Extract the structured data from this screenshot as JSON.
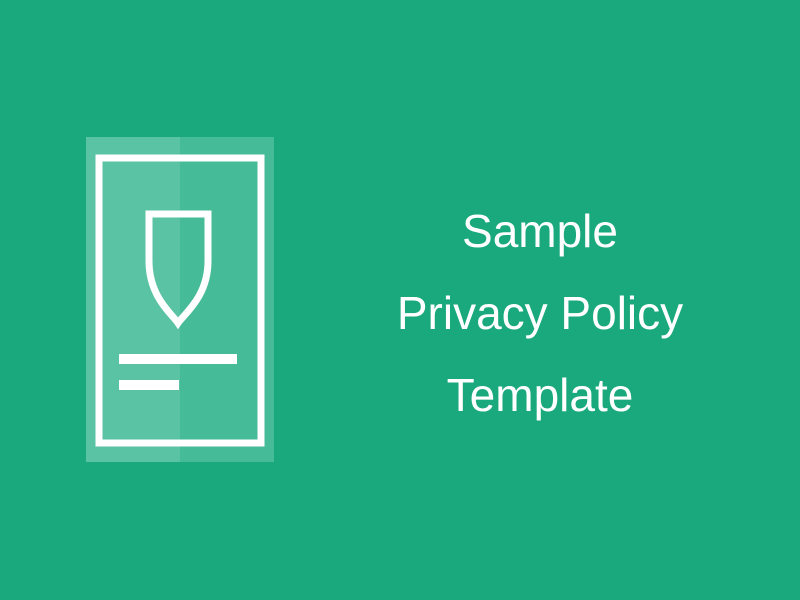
{
  "banner": {
    "background_color": "#19a97c",
    "panel_color": "#46bb97",
    "panel_light_color": "#5ac3a3",
    "accent_color": "#ffffff",
    "icon": "document-shield-icon",
    "title_lines": [
      "Sample",
      "Privacy Policy",
      "Template"
    ]
  }
}
